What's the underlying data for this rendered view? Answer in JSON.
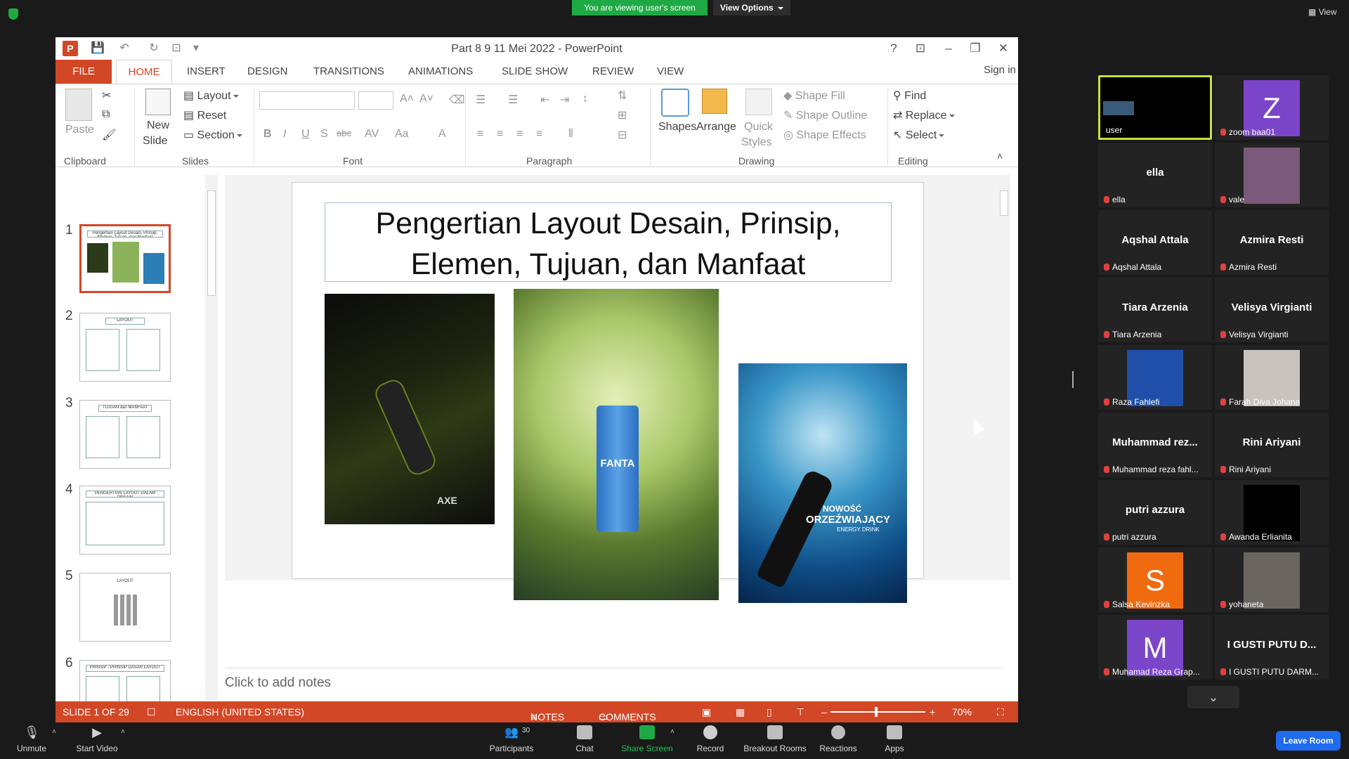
{
  "zoom": {
    "share_banner": "You are viewing user's screen",
    "view_options": "View Options",
    "view_label": "View",
    "toolbar": {
      "unmute": "Unmute",
      "start_video": "Start Video",
      "participants": "Participants",
      "participants_count": "30",
      "chat": "Chat",
      "share_screen": "Share Screen",
      "record": "Record",
      "breakout_rooms": "Breakout Rooms",
      "reactions": "Reactions",
      "apps": "Apps",
      "leave": "Leave Room"
    },
    "participants": [
      {
        "name": "user",
        "type": "screen"
      },
      {
        "name": "zoom baa01",
        "type": "avatar",
        "letter": "Z",
        "color": "#7b45c9"
      },
      {
        "name": "ella",
        "big": "ella",
        "type": "text"
      },
      {
        "name": "vale",
        "type": "photo",
        "color": "#7a5a7a"
      },
      {
        "name": "Aqshal Attala",
        "big": "Aqshal Attala",
        "type": "text"
      },
      {
        "name": "Azmira Resti",
        "big": "Azmira Resti",
        "type": "text"
      },
      {
        "name": "Tiara Arzenia",
        "big": "Tiara Arzenia",
        "type": "text"
      },
      {
        "name": "Velisya Virgianti",
        "big": "Velisya Virgianti",
        "type": "text"
      },
      {
        "name": "Raza Fahlefi",
        "type": "photo",
        "color": "#1f4fa8"
      },
      {
        "name": "Farah Diva Johana",
        "type": "photo",
        "color": "#c9c3bf"
      },
      {
        "name": "Muhammad reza fahl...",
        "big": "Muhammad rez...",
        "type": "text"
      },
      {
        "name": "Rini Ariyani",
        "big": "Rini Ariyani",
        "type": "text"
      },
      {
        "name": "putri azzura",
        "big": "putri azzura",
        "type": "text"
      },
      {
        "name": "Awanda Erlianita",
        "type": "photo",
        "color": "#000000"
      },
      {
        "name": "Salsa Kevinzka",
        "type": "avatar",
        "letter": "S",
        "color": "#f06a0f"
      },
      {
        "name": "yohaneta",
        "type": "photo",
        "color": "#6b6560"
      },
      {
        "name": "Muhamad Reza Grap...",
        "type": "avatar",
        "letter": "M",
        "color": "#7b45c9"
      },
      {
        "name": "I GUSTI PUTU DARM...",
        "big": "I GUSTI PUTU D...",
        "type": "text"
      }
    ]
  },
  "ppt": {
    "window_title": "Part 8 9 11 Mei 2022 - PowerPoint",
    "sign_in": "Sign in",
    "tabs": [
      "FILE",
      "HOME",
      "INSERT",
      "DESIGN",
      "TRANSITIONS",
      "ANIMATIONS",
      "SLIDE SHOW",
      "REVIEW",
      "VIEW"
    ],
    "ribbon": {
      "paste": "Paste",
      "clipboard": "Clipboard",
      "new_slide_1": "New",
      "new_slide_2": "Slide",
      "layout": "Layout",
      "reset": "Reset",
      "section": "Section",
      "slides": "Slides",
      "font": "Font",
      "paragraph": "Paragraph",
      "shapes": "Shapes",
      "arrange": "Arrange",
      "quick_1": "Quick",
      "quick_2": "Styles",
      "shape_fill": "Shape Fill",
      "shape_outline": "Shape Outline",
      "shape_effects": "Shape Effects",
      "drawing": "Drawing",
      "find": "Find",
      "replace": "Replace",
      "select": "Select",
      "editing": "Editing",
      "bold": "B",
      "italic": "I",
      "underline": "U",
      "shadow": "S",
      "strike": "abc",
      "case": "Aa"
    },
    "thumbnails": [
      {
        "num": "1",
        "title": "Pengertian Layout Desain, Prinsip, Elemen, Tujuan, dan Manfaat"
      },
      {
        "num": "2",
        "title": "LAYOUT"
      },
      {
        "num": "3",
        "title": "TUJUAN dan MANFAAT"
      },
      {
        "num": "4",
        "title": "PENGERTIAN LAYOUT DALAM DESAIN"
      },
      {
        "num": "5",
        "title": "LAYOUT"
      },
      {
        "num": "6",
        "title": "PRINSIP - PRINSIP DASAR LAYOUT"
      }
    ],
    "slide": {
      "title_line1": "Pengertian Layout Desain, Prinsip,",
      "title_line2": "Elemen, Tujuan, dan Manfaat",
      "img1_caption": "AXE",
      "img2_caption": "FANTA",
      "img3_caption_1": "NOWOŚĆ",
      "img3_caption_2": "ORZEŹWIAJĄCY",
      "img3_caption_3": "ENERGY DRINK"
    },
    "notes_placeholder": "Click to add notes",
    "status": {
      "slide_of": "SLIDE 1 OF 29",
      "language": "ENGLISH (UNITED STATES)",
      "notes": "NOTES",
      "comments": "COMMENTS",
      "zoom": "70%"
    }
  }
}
